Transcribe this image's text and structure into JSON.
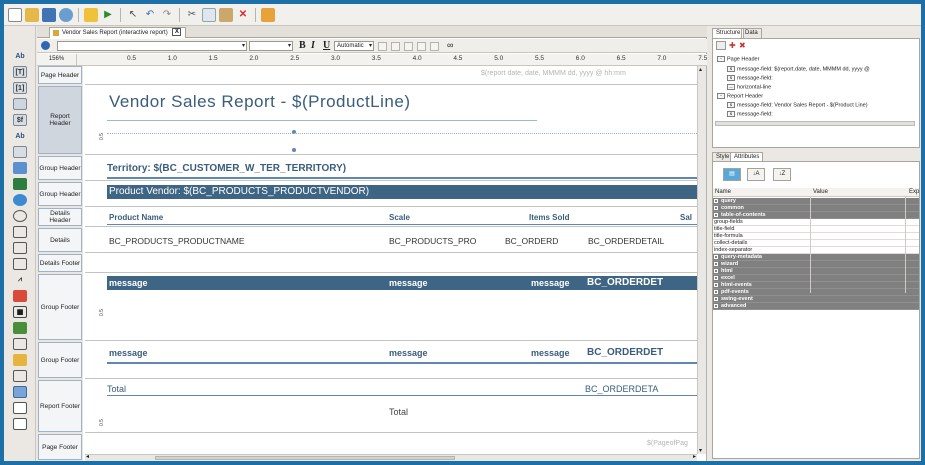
{
  "toolbar": {
    "icons": [
      "new-icon",
      "open-icon",
      "save-icon",
      "publish-icon",
      "preview-icon",
      "run-icon",
      "pointer-icon",
      "undo-icon",
      "redo-icon",
      "cut-icon",
      "copy-icon",
      "paste-icon",
      "delete-icon",
      "layout-icon"
    ]
  },
  "editor": {
    "tab_label": "Vendor Sales Report (interactive report)",
    "tab_close": "X",
    "format": {
      "bold": "B",
      "italic": "I",
      "underline": "U",
      "color_value": "Automatic",
      "extra_symbol": "∞"
    },
    "zoom": "156%",
    "ruler_ticks": [
      "0.5",
      "1.0",
      "1.5",
      "2.0",
      "2.5",
      "3.0",
      "3.5",
      "4.0",
      "4.5",
      "5.0",
      "5.5",
      "6.0",
      "6.5",
      "7.0",
      "7.5"
    ],
    "vert_mark": "0.5"
  },
  "bands": [
    {
      "label": "Page Header"
    },
    {
      "label": "Report Header"
    },
    {
      "label": "Group Header"
    },
    {
      "label": "Group Header"
    },
    {
      "label": "Details Header"
    },
    {
      "label": "Details"
    },
    {
      "label": "Details Footer"
    },
    {
      "label": "Group Footer"
    },
    {
      "label": "Group Footer"
    },
    {
      "label": "Report Footer"
    },
    {
      "label": "Page Footer"
    }
  ],
  "canvas": {
    "page_header_field": "$(report date, date, MMMM dd, yyyy @ hh:mm",
    "report_title": "Vendor Sales Report - $(ProductLine)",
    "territory": "Territory: $(BC_CUSTOMER_W_TER_TERRITORY)",
    "product_vendor": "Product Vendor: $(BC_PRODUCTS_PRODUCTVENDOR)",
    "details_header": {
      "product_name": "Product Name",
      "scale": "Scale",
      "items_sold": "Items Sold",
      "sales": "Sal"
    },
    "details": {
      "product_name": "BC_PRODUCTS_PRODUCTNAME",
      "scale": "BC_PRODUCTS_PRO",
      "items_sold": "BC_ORDERD",
      "sales": "BC_ORDERDETAIL"
    },
    "group_footer_1": {
      "c1": "message",
      "c2": "message",
      "c3": "message",
      "c4": "BC_ORDERDET"
    },
    "group_footer_2": {
      "c1": "message",
      "c2": "message",
      "c3": "message",
      "c4": "BC_ORDERDET"
    },
    "report_footer": {
      "total_left": "Total",
      "total_value": "BC_ORDERDETA",
      "total_mid": "Total"
    },
    "page_footer_field": "$(PageofPag"
  },
  "right_panel": {
    "top_tabs": [
      "Structure",
      "Data"
    ],
    "tree": [
      {
        "label": "Page Header",
        "kind": "folder"
      },
      {
        "label": "message-field: $(report.date, date, MMMM dd, yyyy @",
        "kind": "field"
      },
      {
        "label": "message-field:",
        "kind": "field"
      },
      {
        "label": "horizontal-line",
        "kind": "line"
      },
      {
        "label": "Report Header",
        "kind": "folder"
      },
      {
        "label": "message-field: Vendor Sales Report - $(Product Line)",
        "kind": "field"
      },
      {
        "label": "message-field:",
        "kind": "field"
      }
    ],
    "style_tabs": [
      "Style",
      "Attributes"
    ],
    "grid_headers": [
      "Name",
      "Value",
      "Exp"
    ],
    "properties": [
      {
        "name": "query",
        "group": true
      },
      {
        "name": "common",
        "group": true
      },
      {
        "name": "table-of-contents",
        "group": true
      },
      {
        "name": "group-fields",
        "group": false
      },
      {
        "name": "title-field",
        "group": false
      },
      {
        "name": "title-formula",
        "group": false
      },
      {
        "name": "collect-details",
        "group": false
      },
      {
        "name": "index-separator",
        "group": false
      },
      {
        "name": "query-metadata",
        "group": true
      },
      {
        "name": "wizard",
        "group": true
      },
      {
        "name": "html",
        "group": true
      },
      {
        "name": "excel",
        "group": true
      },
      {
        "name": "html-events",
        "group": true
      },
      {
        "name": "pdf-events",
        "group": true
      },
      {
        "name": "swing-event",
        "group": true
      },
      {
        "name": "advanced",
        "group": true
      }
    ]
  },
  "colors": {
    "frame_blue": "#1d6fa8",
    "band_dark": "#3f6585",
    "title_text": "#3a5d7c",
    "line_blue": "#5f87b1",
    "group_gray": "#808080"
  }
}
